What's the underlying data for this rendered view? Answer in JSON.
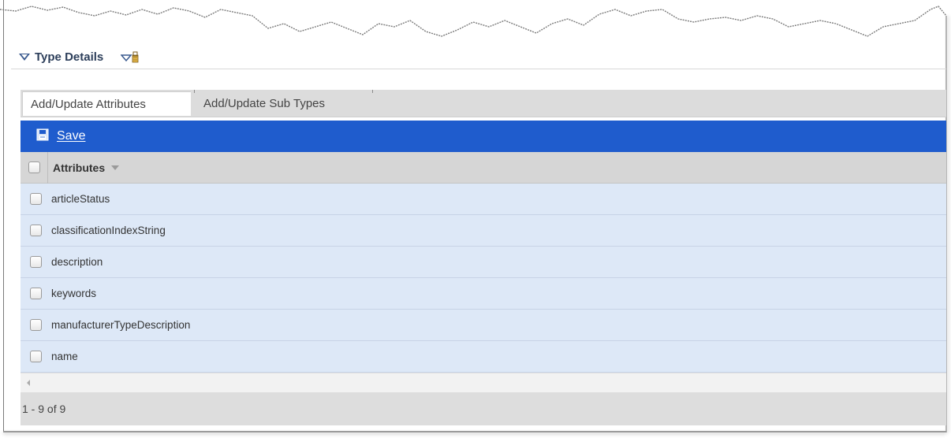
{
  "section": {
    "title": "Type Details",
    "collapse_icon": "triangle-down-icon",
    "filter_icon": "filter-icon"
  },
  "tabs": [
    {
      "label": "Add/Update Attributes",
      "active": true
    },
    {
      "label": "Add/Update Sub Types",
      "active": false
    }
  ],
  "toolbar": {
    "save_icon": "floppy-disk-icon",
    "save_label": "Save"
  },
  "grid": {
    "header": "Attributes",
    "rows": [
      "articleStatus",
      "classificationIndexString",
      "description",
      "keywords",
      "manufacturerTypeDescription",
      "name"
    ],
    "pager_text": "1 - 9 of 9"
  },
  "colors": {
    "toolbar": "#1f5ccd",
    "row_bg": "#dde8f7",
    "header_bg": "#d6d6d6"
  }
}
